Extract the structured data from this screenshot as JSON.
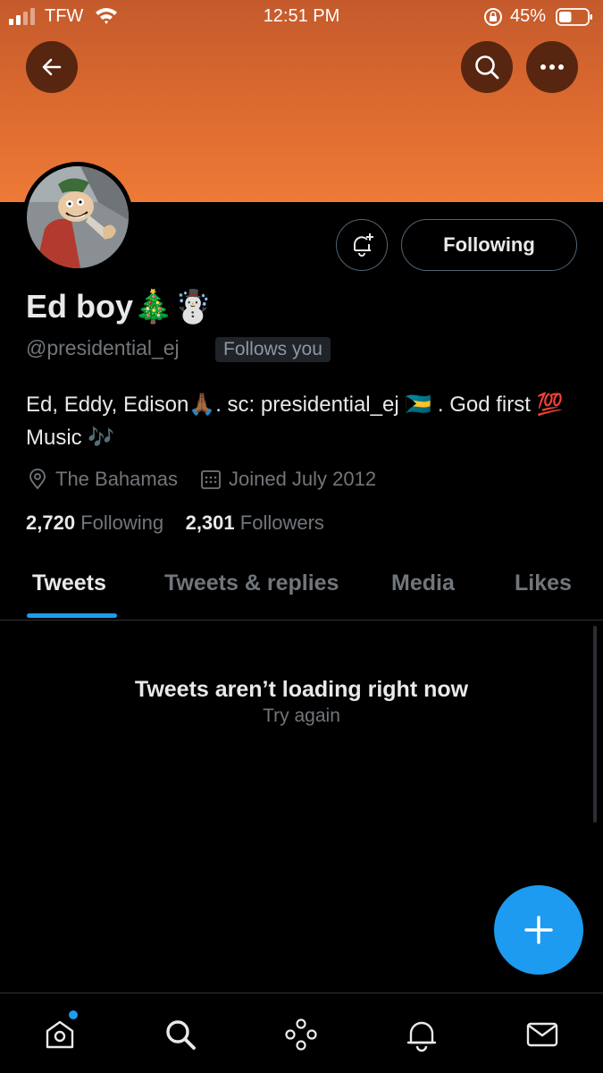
{
  "status_bar": {
    "carrier": "TFW",
    "time": "12:51 PM",
    "battery_percent": "45%",
    "battery_level": 0.45
  },
  "header": {
    "banner_color_top": "#c45a2c",
    "banner_color_bottom": "#ee7a36",
    "back_icon": "back-arrow-icon",
    "search_icon": "search-icon",
    "more_icon": "more-icon"
  },
  "profile": {
    "display_name": "Ed boy🎄☃️",
    "handle": "@presidential_ej",
    "follows_you_badge": "Follows you",
    "bio": "Ed, Eddy, Edison🙏🏾. sc: presidential_ej 🇧🇸 . God first 💯 Music 🎶",
    "location": "The Bahamas",
    "joined": "Joined July 2012",
    "following_count": "2,720",
    "following_label": "Following",
    "followers_count": "2,301",
    "followers_label": "Followers",
    "follow_button_label": "Following"
  },
  "tabs": [
    {
      "label": "Tweets",
      "active": true
    },
    {
      "label": "Tweets & replies",
      "active": false
    },
    {
      "label": "Media",
      "active": false
    },
    {
      "label": "Likes",
      "active": false
    }
  ],
  "timeline": {
    "error_title": "Tweets aren’t loading right now",
    "retry_label": "Try again"
  },
  "bottom_nav": [
    {
      "icon": "home-icon",
      "has_notification": true
    },
    {
      "icon": "search-icon",
      "has_notification": false
    },
    {
      "icon": "spaces-icon",
      "has_notification": false
    },
    {
      "icon": "notifications-icon",
      "has_notification": false
    },
    {
      "icon": "messages-icon",
      "has_notification": false
    }
  ],
  "colors": {
    "accent": "#1d9bf0",
    "background": "#000000",
    "primary_text": "#e7e9ea",
    "secondary_text": "#71767b"
  }
}
